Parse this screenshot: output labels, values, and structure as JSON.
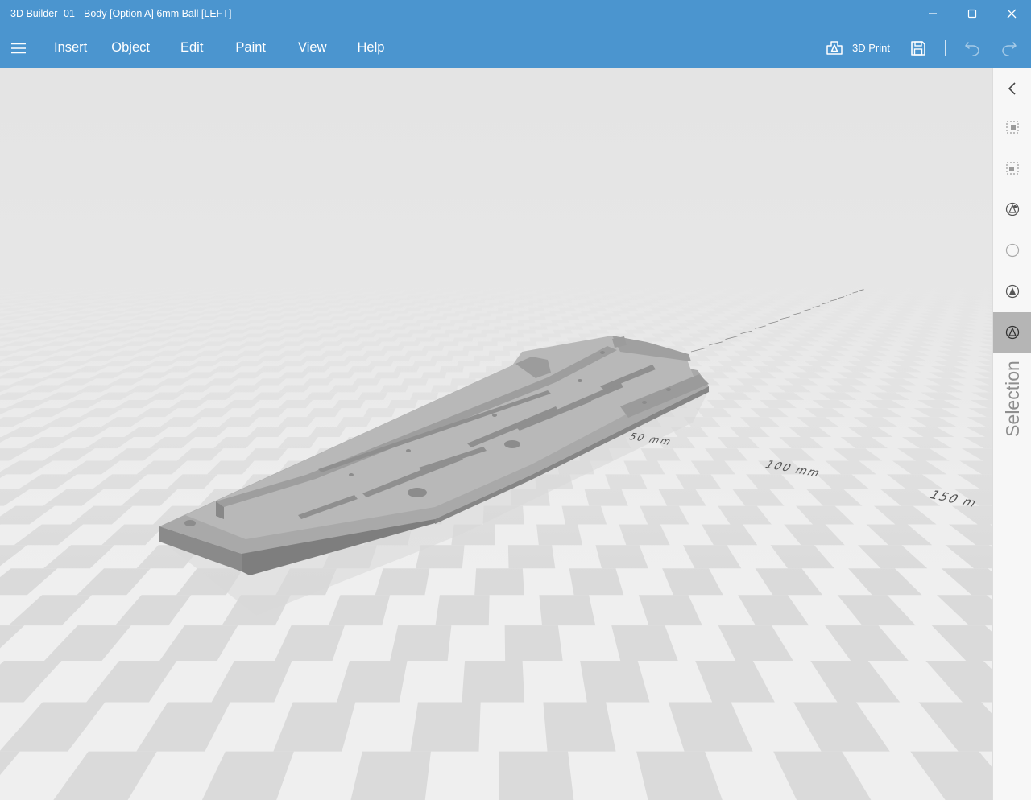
{
  "window": {
    "title": "3D Builder -01 - Body [Option A] 6mm Ball [LEFT]",
    "minimize_icon": "minimize-icon",
    "maximize_icon": "maximize-icon",
    "close_icon": "close-icon"
  },
  "menu": {
    "hamburger_icon": "hamburger-icon",
    "items": [
      "Insert",
      "Object",
      "Edit",
      "Paint",
      "View",
      "Help"
    ]
  },
  "toolbar": {
    "print_label": "3D Print",
    "print_icon": "3d-print-icon",
    "save_icon": "save-icon",
    "undo_icon": "undo-icon",
    "redo_icon": "redo-icon"
  },
  "viewport": {
    "ruler_labels": [
      "50 mm",
      "100 mm",
      "150 m"
    ]
  },
  "right_panel": {
    "collapse_icon": "chevron-left-icon",
    "selection_label": "Selection",
    "buttons": [
      "select-objects-icon",
      "select-group-icon",
      "select-vertex-icon",
      "select-empty-icon",
      "select-face-icon",
      "select-mesh-icon"
    ]
  },
  "colors": {
    "accent": "#4b95cf",
    "model": "#9a9a9a",
    "floor_light": "#efefef",
    "floor_dark": "#dadada",
    "panel": "#f7f7f7",
    "active": "#b5b5b5"
  }
}
